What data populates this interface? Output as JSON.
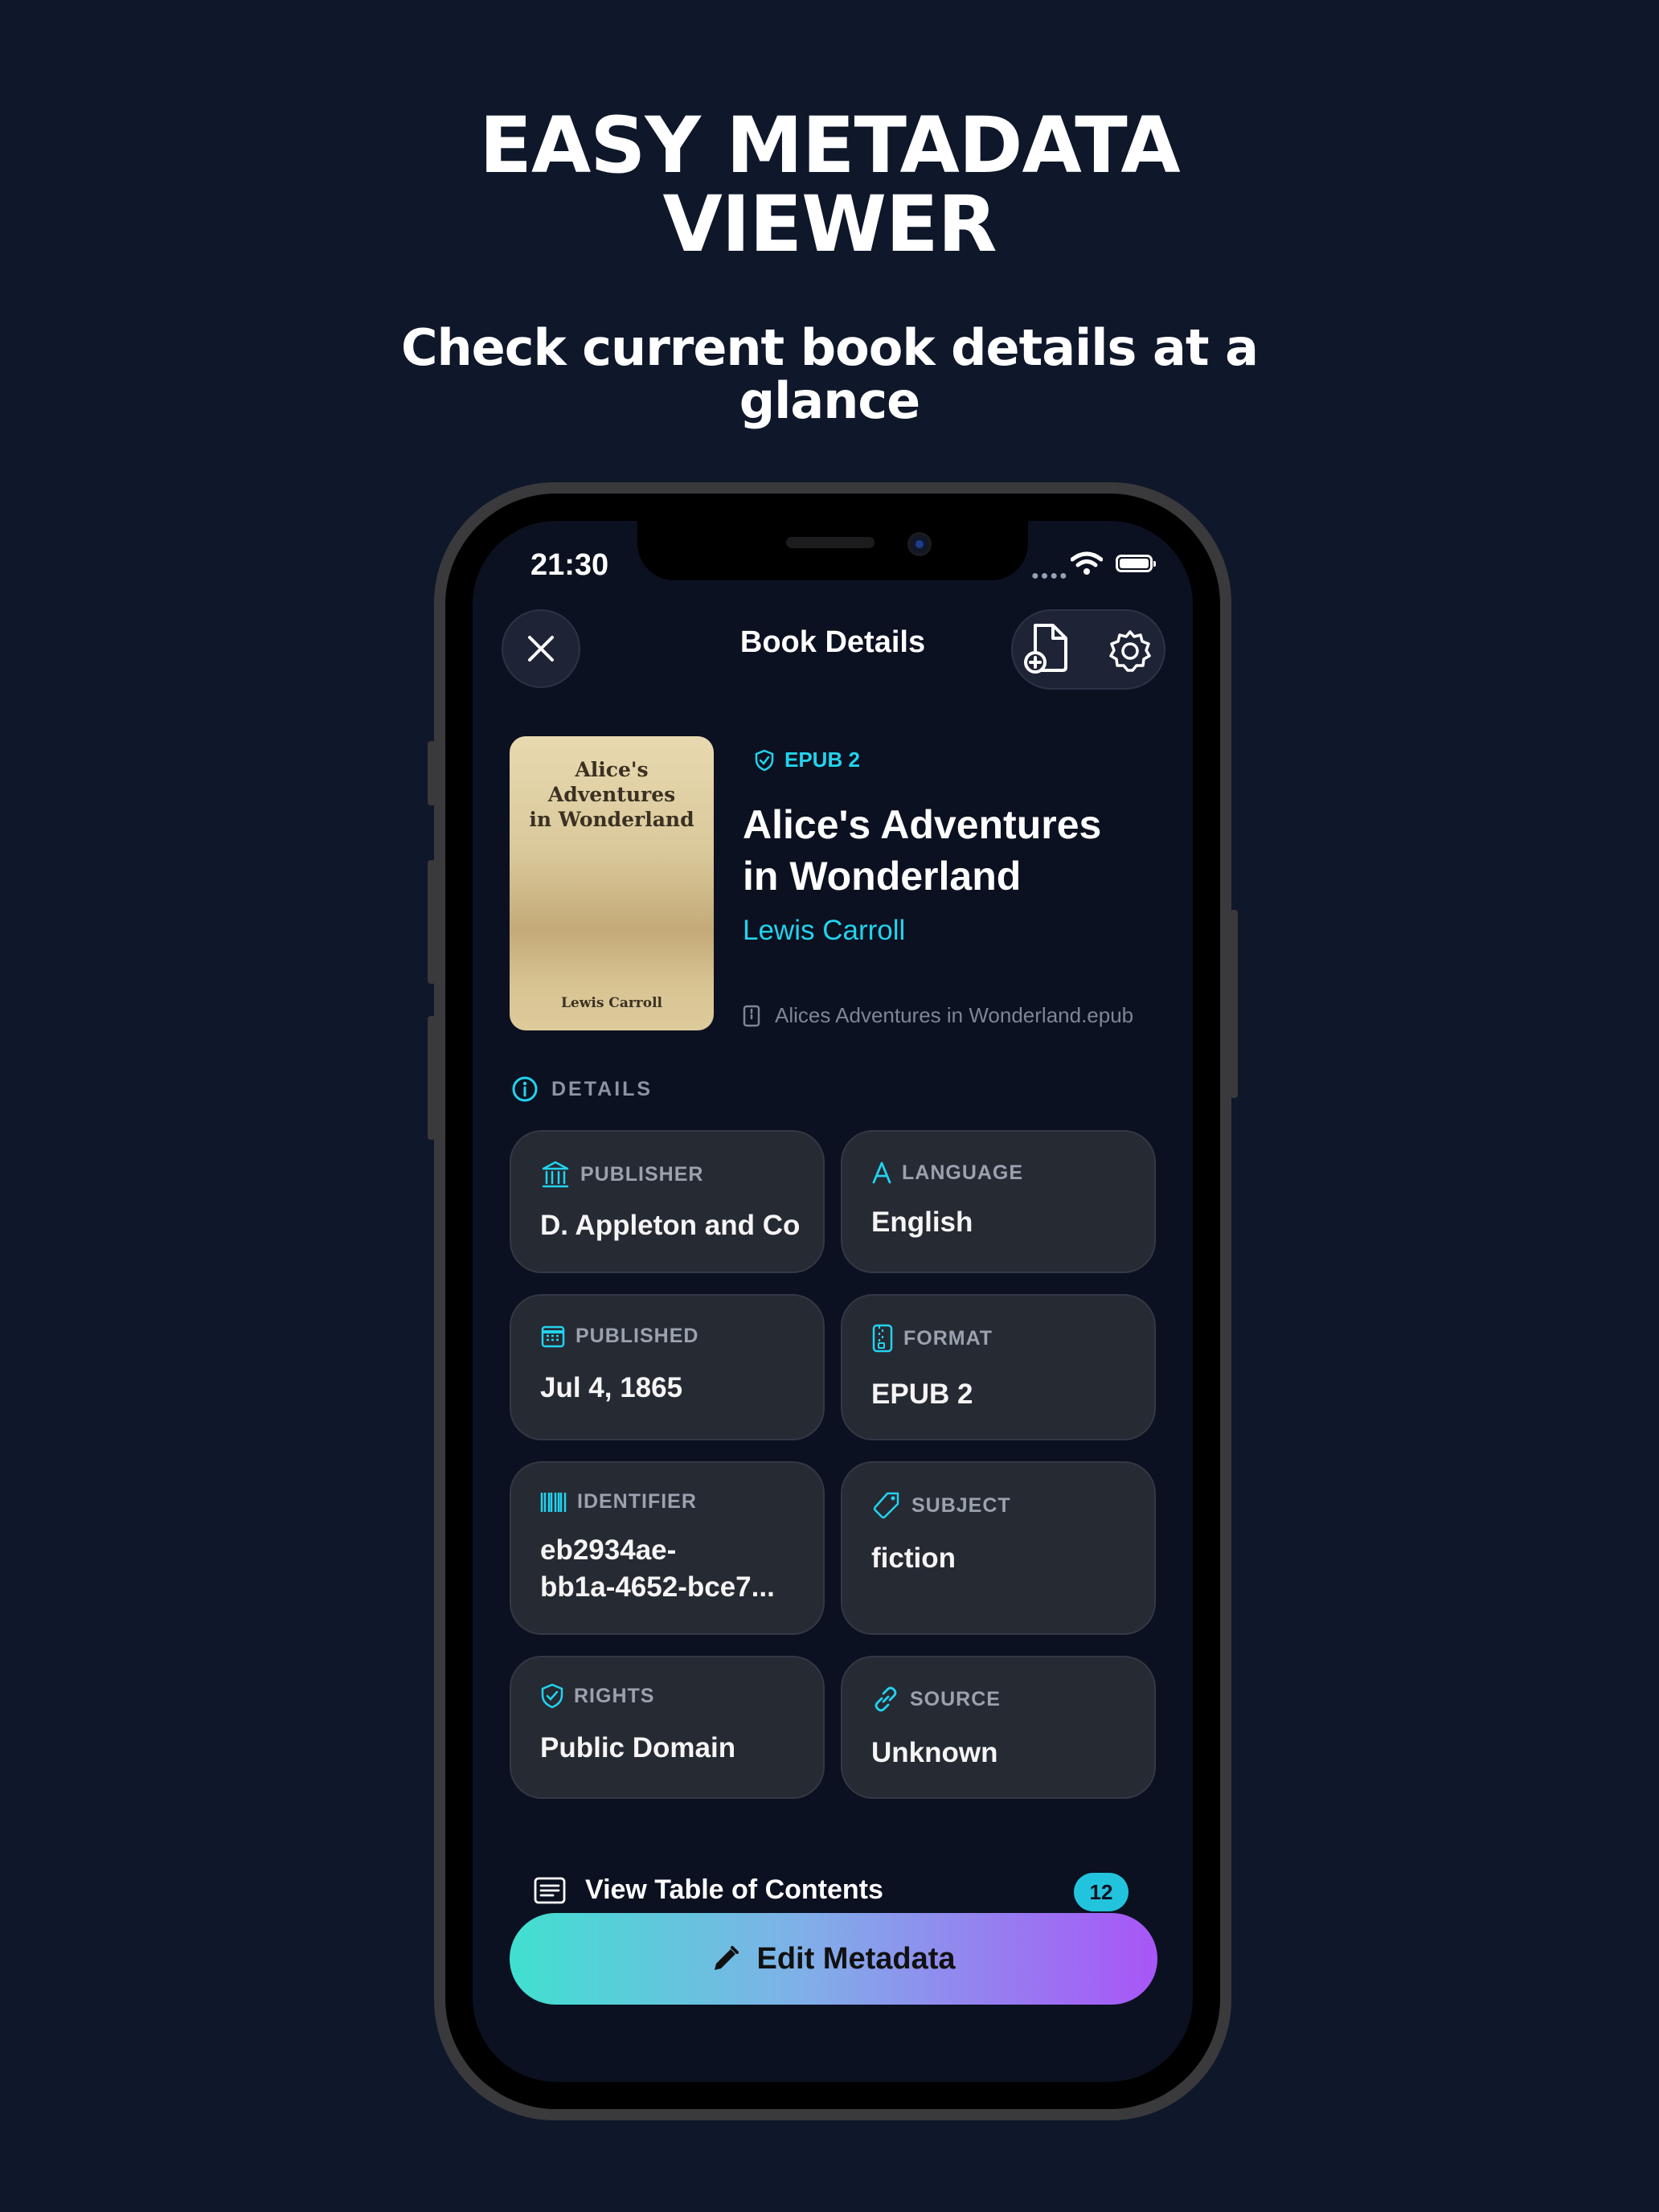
{
  "headline": {
    "line1": "EASY METADATA",
    "line2": "VIEWER"
  },
  "subheadline": {
    "line1": "Check current book details at a",
    "line2": "glance"
  },
  "status_bar": {
    "time": "21:30"
  },
  "nav": {
    "title": "Book Details"
  },
  "book": {
    "format_badge": "EPUB 2",
    "title_line1": "Alice's Adventures",
    "title_line2": "in Wonderland",
    "author": "Lewis Carroll",
    "filename": "Alices Adventures in Wonderland.epub",
    "cover_title_line1": "Alice's Adventures",
    "cover_title_line2": "in Wonderland",
    "cover_author": "Lewis Carroll"
  },
  "details": {
    "section_label": "DETAILS",
    "cards": [
      {
        "key": "publisher",
        "label": "PUBLISHER",
        "value_line1": "D. Appleton and Co",
        "value_line2": "",
        "icon": "bank-icon"
      },
      {
        "key": "language",
        "label": "LANGUAGE",
        "value_line1": "English",
        "value_line2": "",
        "icon": "language-icon"
      },
      {
        "key": "published",
        "label": "PUBLISHED",
        "value_line1": "Jul 4, 1865",
        "value_line2": "",
        "icon": "calendar-icon"
      },
      {
        "key": "format",
        "label": "FORMAT",
        "value_line1": "EPUB 2",
        "value_line2": "",
        "icon": "zip-file-icon"
      },
      {
        "key": "identifier",
        "label": "IDENTIFIER",
        "value_line1": "eb2934ae-",
        "value_line2": "bb1a-4652-bce7...",
        "icon": "barcode-icon"
      },
      {
        "key": "subject",
        "label": "SUBJECT",
        "value_line1": "fiction",
        "value_line2": "",
        "icon": "tag-icon"
      },
      {
        "key": "rights",
        "label": "RIGHTS",
        "value_line1": "Public Domain",
        "value_line2": "",
        "icon": "shield-check-icon"
      },
      {
        "key": "source",
        "label": "SOURCE",
        "value_line1": "Unknown",
        "value_line2": "",
        "icon": "link-icon"
      }
    ]
  },
  "toc": {
    "label": "View Table of Contents",
    "count": "12"
  },
  "edit_button": {
    "label": "Edit Metadata"
  },
  "colors": {
    "accent": "#22d3ee",
    "background": "#0f172a",
    "card": "#262a33",
    "gradient_start": "#40e0d0",
    "gradient_end": "#a855f7"
  }
}
